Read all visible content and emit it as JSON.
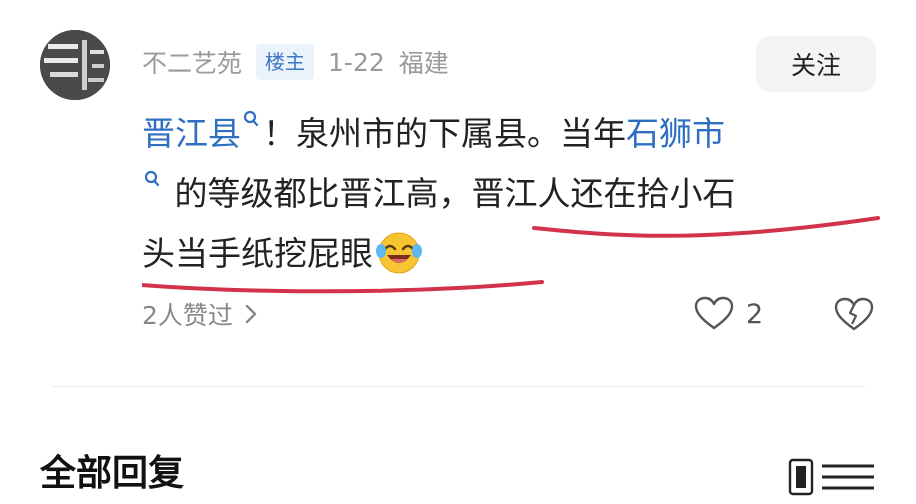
{
  "post": {
    "author": "不二艺苑",
    "badge": "楼主",
    "date": "1-22",
    "location": "福建",
    "follow_label": "关注",
    "line1": {
      "link1": "晋江县",
      "text1": "！泉州市的下属县。当年",
      "link2": "石狮市"
    },
    "line2": {
      "text": "的等级都比晋江高，晋江人还在拾小石"
    },
    "line3": {
      "text": "头当手纸挖屁眼"
    },
    "likers": "2人赞过",
    "like_count": "2"
  },
  "replies": {
    "title": "全部回复"
  },
  "colors": {
    "link": "#2f6fc3",
    "underline": "#d2334b",
    "badge_text": "#3c76c4",
    "badge_bg": "#eaf2fb"
  },
  "icons": [
    "search-icon",
    "laughing-emoji-icon",
    "chevron-right-icon",
    "heart-icon",
    "broken-heart-icon",
    "sort-icon"
  ]
}
